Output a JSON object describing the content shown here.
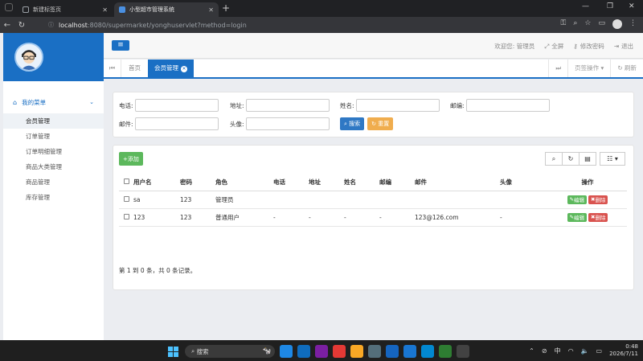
{
  "browser": {
    "tabs": [
      {
        "label": "新建标签页"
      },
      {
        "label": "小型超市管理系统"
      }
    ],
    "url_host": "localhost",
    "url_rest": ":8080/supermarket/yonghuservlet?method=login"
  },
  "header": {
    "welcome": "欢迎您: 管理员",
    "fullscreen": "全屏",
    "change_password": "修改密码",
    "logout": "退出"
  },
  "sidebar": {
    "menu_title": "我的菜单",
    "items": [
      {
        "label": "会员管理",
        "active": true
      },
      {
        "label": "订单管理"
      },
      {
        "label": "订单明细管理"
      },
      {
        "label": "商品大类管理"
      },
      {
        "label": "商品管理"
      },
      {
        "label": "库存管理"
      }
    ]
  },
  "page_tabs": {
    "home": "首页",
    "active": "会员管理",
    "tab_ops": "页签操作",
    "refresh": "刷新"
  },
  "search_form": {
    "phone_label": "电话:",
    "address_label": "地址:",
    "name_label": "姓名:",
    "zip_label": "邮编:",
    "email_label": "邮件:",
    "avatar_label": "头像:",
    "search_button": "搜索",
    "reset_button": "重置",
    "values": {
      "phone": "",
      "address": "",
      "name": "",
      "zip": "",
      "email": "",
      "avatar": ""
    }
  },
  "table": {
    "add_button": "+添加",
    "columns": [
      "用户名",
      "密码",
      "角色",
      "电话",
      "地址",
      "姓名",
      "邮编",
      "邮件",
      "头像",
      "操作"
    ],
    "rows": [
      [
        "sa",
        "123",
        "管理员",
        "",
        "",
        "",
        "",
        "",
        ""
      ],
      [
        "123",
        "123",
        "普通用户",
        "-",
        "-",
        "-",
        "-",
        "123@126.com",
        "-"
      ]
    ],
    "edit_label": "编辑",
    "delete_label": "删除",
    "pager_text": "第 1 到 0 条，共 0 条记录。"
  },
  "taskbar": {
    "search_label": "搜索",
    "ime": "中",
    "time": "0:48",
    "date": "2026/7/11"
  },
  "colors": {
    "primary": "#1a6fc4",
    "success": "#5cb85c",
    "danger": "#d9534f",
    "warning": "#f0ad4e"
  }
}
